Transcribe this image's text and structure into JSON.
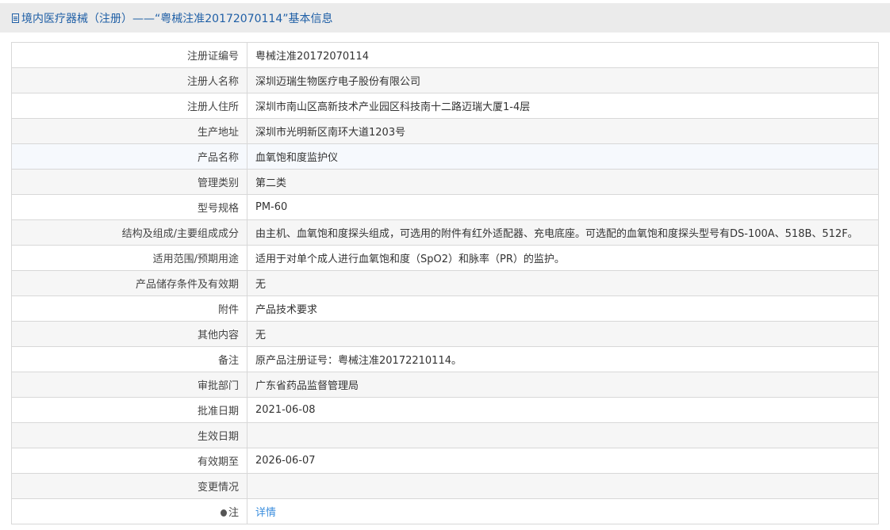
{
  "header": {
    "title": "境内医疗器械（注册）——“粤械注准20172070114”基本信息"
  },
  "rows": [
    {
      "label": "注册证编号",
      "value": "粤械注准20172070114"
    },
    {
      "label": "注册人名称",
      "value": "深圳迈瑞生物医疗电子股份有限公司"
    },
    {
      "label": "注册人住所",
      "value": "深圳市南山区高新技术产业园区科技南十二路迈瑞大厦1-4层"
    },
    {
      "label": "生产地址",
      "value": "深圳市光明新区南环大道1203号"
    },
    {
      "label": "产品名称",
      "value": "血氧饱和度监护仪"
    },
    {
      "label": "管理类别",
      "value": "第二类"
    },
    {
      "label": "型号规格",
      "value": "PM-60"
    },
    {
      "label": "结构及组成/主要组成成分",
      "value": "由主机、血氧饱和度探头组成，可选用的附件有红外适配器、充电底座。可选配的血氧饱和度探头型号有DS-100A、518B、512F。"
    },
    {
      "label": "适用范围/预期用途",
      "value": "适用于对单个成人进行血氧饱和度（SpO2）和脉率（PR）的监护。"
    },
    {
      "label": "产品储存条件及有效期",
      "value": "无"
    },
    {
      "label": "附件",
      "value": "产品技术要求"
    },
    {
      "label": "其他内容",
      "value": "无"
    },
    {
      "label": "备注",
      "value": "原产品注册证号：粤械注准20172210114。"
    },
    {
      "label": "审批部门",
      "value": "广东省药品监督管理局"
    },
    {
      "label": "批准日期",
      "value": "2021-06-08"
    },
    {
      "label": "生效日期",
      "value": ""
    },
    {
      "label": "有效期至",
      "value": "2026-06-07"
    },
    {
      "label": "变更情况",
      "value": ""
    }
  ],
  "note": {
    "label": "注",
    "link": "详情"
  }
}
